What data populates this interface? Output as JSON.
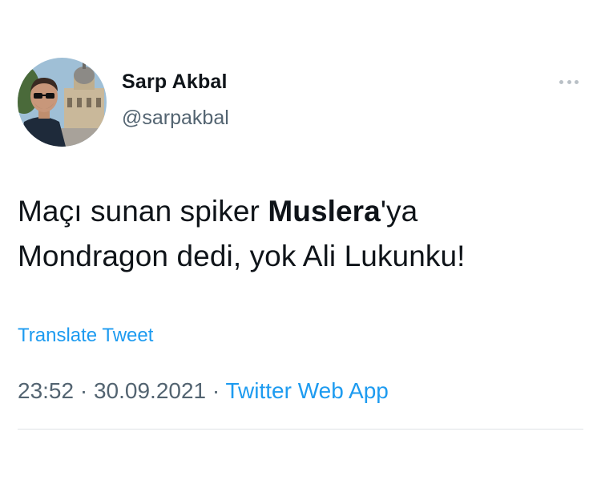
{
  "author": {
    "name": "Sarp Akbal",
    "handle": "@sarpakbal"
  },
  "tweet": {
    "line1_pre": "Maçı sunan spiker ",
    "line1_bold": "Muslera",
    "line1_post": "'ya",
    "line2": "Mondragon dedi, yok Ali Lukunku!"
  },
  "translate_label": "Translate Tweet",
  "meta": {
    "time": "23:52",
    "separator": " · ",
    "date": "30.09.2021",
    "source": "Twitter Web App"
  },
  "icons": {
    "more": "more-horizontal-icon"
  },
  "colors": {
    "link": "#1d9bf0",
    "secondary_text": "#536471",
    "primary_text": "#0f1419"
  }
}
